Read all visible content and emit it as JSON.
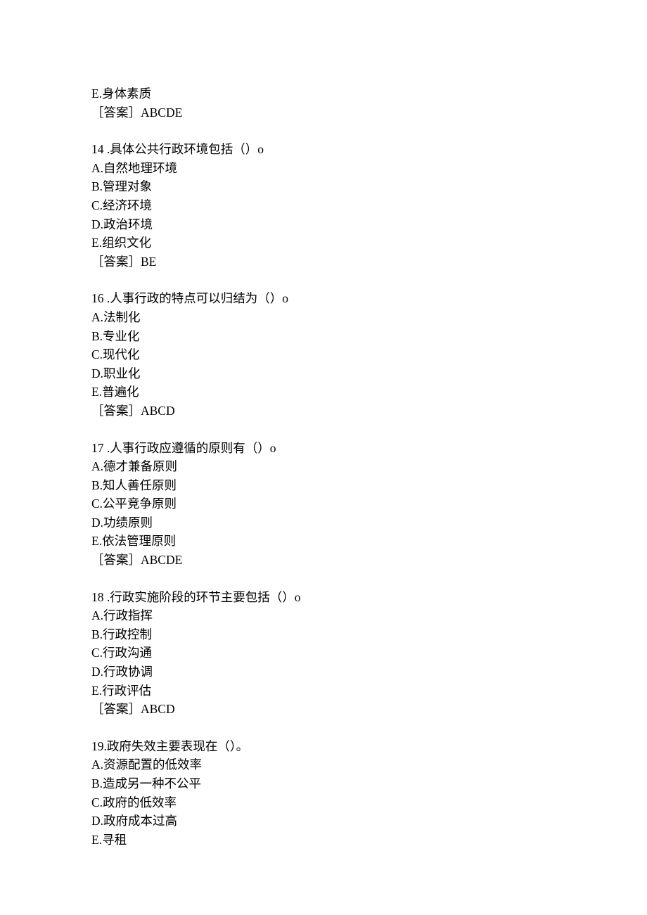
{
  "q13_tail": {
    "optE": "E.身体素质",
    "answer": "［答案］ABCDE"
  },
  "q14": {
    "stem": "14 .具体公共行政环境包括（）o",
    "optA": "A.自然地理环境",
    "optB": "B.管理对象",
    "optC": "C.经济环境",
    "optD": "D.政治环境",
    "optE": "E.组织文化",
    "answer": "［答案］BE"
  },
  "q16": {
    "stem": "16 .人事行政的特点可以归结为（）o",
    "optA": "A.法制化",
    "optB": "B.专业化",
    "optC": "C.现代化",
    "optD": "D.职业化",
    "optE": "E.普遍化",
    "answer": "［答案］ABCD"
  },
  "q17": {
    "stem": "17 .人事行政应遵循的原则有（）o",
    "optA": "A.德才兼备原则",
    "optB": "B.知人善任原则",
    "optC": "C.公平竞争原则",
    "optD": "D.功绩原则",
    "optE": "E.依法管理原则",
    "answer": "［答案］ABCDE"
  },
  "q18": {
    "stem": "18 .行政实施阶段的环节主要包括（）o",
    "optA": "A.行政指挥",
    "optB": "B.行政控制",
    "optC": "C.行政沟通",
    "optD": "D.行政协调",
    "optE": "E.行政评估",
    "answer": "［答案］ABCD"
  },
  "q19": {
    "stem": "19.政府失效主要表现在（）。",
    "optA": "A.资源配置的低效率",
    "optB": "B.造成另一种不公平",
    "optC": "C.政府的低效率",
    "optD": "D.政府成本过高",
    "optE": "E.寻租"
  }
}
